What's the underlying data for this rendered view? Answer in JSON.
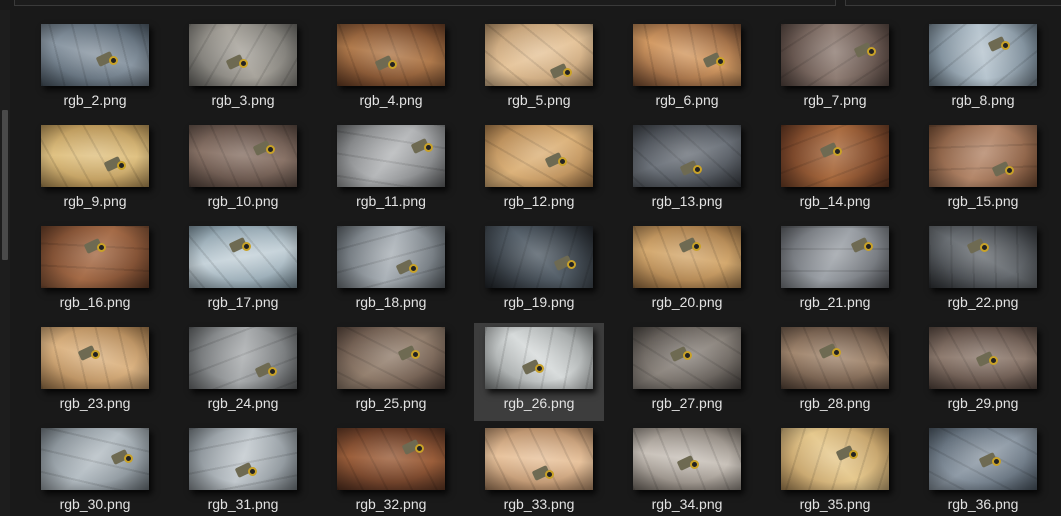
{
  "files": [
    {
      "name": "rgb_2.png",
      "bg": "#4d5a66",
      "accent": "#8a97a3",
      "selected": false
    },
    {
      "name": "rgb_3.png",
      "bg": "#6f6e6a",
      "accent": "#a8a49c",
      "selected": false
    },
    {
      "name": "rgb_4.png",
      "bg": "#6b4026",
      "accent": "#b07a4c",
      "selected": false
    },
    {
      "name": "rgb_5.png",
      "bg": "#b5926a",
      "accent": "#e6c59b",
      "selected": false
    },
    {
      "name": "rgb_6.png",
      "bg": "#7a4f33",
      "accent": "#d39a63",
      "selected": false
    },
    {
      "name": "rgb_7.png",
      "bg": "#5a4a44",
      "accent": "#8f7d74",
      "selected": false
    },
    {
      "name": "rgb_8.png",
      "bg": "#6f7f8c",
      "accent": "#b7c5cf",
      "selected": false
    },
    {
      "name": "rgb_9.png",
      "bg": "#b89558",
      "accent": "#e0c283",
      "selected": false
    },
    {
      "name": "rgb_10.png",
      "bg": "#5b4a42",
      "accent": "#8a7468",
      "selected": false
    },
    {
      "name": "rgb_11.png",
      "bg": "#6a6c6e",
      "accent": "#b5b7b9",
      "selected": false
    },
    {
      "name": "rgb_12.png",
      "bg": "#a87c4b",
      "accent": "#dcb27a",
      "selected": false
    },
    {
      "name": "rgb_13.png",
      "bg": "#3c4046",
      "accent": "#6e747c",
      "selected": false
    },
    {
      "name": "rgb_14.png",
      "bg": "#6a3b24",
      "accent": "#a96a3e",
      "selected": false
    },
    {
      "name": "rgb_15.png",
      "bg": "#7b5238",
      "accent": "#b4876a",
      "selected": false
    },
    {
      "name": "rgb_16.png",
      "bg": "#6a4029",
      "accent": "#a56b47",
      "selected": false
    },
    {
      "name": "rgb_17.png",
      "bg": "#8196a2",
      "accent": "#c6d3da",
      "selected": false
    },
    {
      "name": "rgb_18.png",
      "bg": "#5f666c",
      "accent": "#aab1b7",
      "selected": false
    },
    {
      "name": "rgb_19.png",
      "bg": "#23272c",
      "accent": "#55606a",
      "selected": false
    },
    {
      "name": "rgb_20.png",
      "bg": "#9e7445",
      "accent": "#d4a96f",
      "selected": false
    },
    {
      "name": "rgb_21.png",
      "bg": "#5e6166",
      "accent": "#9da2a8",
      "selected": false
    },
    {
      "name": "rgb_22.png",
      "bg": "#33363a",
      "accent": "#6b7075",
      "selected": false
    },
    {
      "name": "rgb_23.png",
      "bg": "#a67d4f",
      "accent": "#dcb483",
      "selected": false
    },
    {
      "name": "rgb_24.png",
      "bg": "#676a6c",
      "accent": "#a9acae",
      "selected": false
    },
    {
      "name": "rgb_25.png",
      "bg": "#5c4a40",
      "accent": "#94806f",
      "selected": false
    },
    {
      "name": "rgb_26.png",
      "bg": "#8a8e8e",
      "accent": "#d7dbdb",
      "selected": true
    },
    {
      "name": "rgb_27.png",
      "bg": "#4f4a46",
      "accent": "#8c857e",
      "selected": false
    },
    {
      "name": "rgb_28.png",
      "bg": "#5e4b3e",
      "accent": "#a2876f",
      "selected": false
    },
    {
      "name": "rgb_29.png",
      "bg": "#5b4b43",
      "accent": "#8f7c70",
      "selected": false
    },
    {
      "name": "rgb_30.png",
      "bg": "#727b82",
      "accent": "#b5bec4",
      "selected": false
    },
    {
      "name": "rgb_31.png",
      "bg": "#7a8288",
      "accent": "#c2c9ce",
      "selected": false
    },
    {
      "name": "rgb_32.png",
      "bg": "#5c3523",
      "accent": "#9c5f3b",
      "selected": false
    },
    {
      "name": "rgb_33.png",
      "bg": "#b08763",
      "accent": "#e8c39d",
      "selected": false
    },
    {
      "name": "rgb_34.png",
      "bg": "#7e766e",
      "accent": "#c9c2ba",
      "selected": false
    },
    {
      "name": "rgb_35.png",
      "bg": "#b38f5a",
      "accent": "#e6c98e",
      "selected": false
    },
    {
      "name": "rgb_36.png",
      "bg": "#4e5a66",
      "accent": "#8e9aa6",
      "selected": false
    }
  ]
}
